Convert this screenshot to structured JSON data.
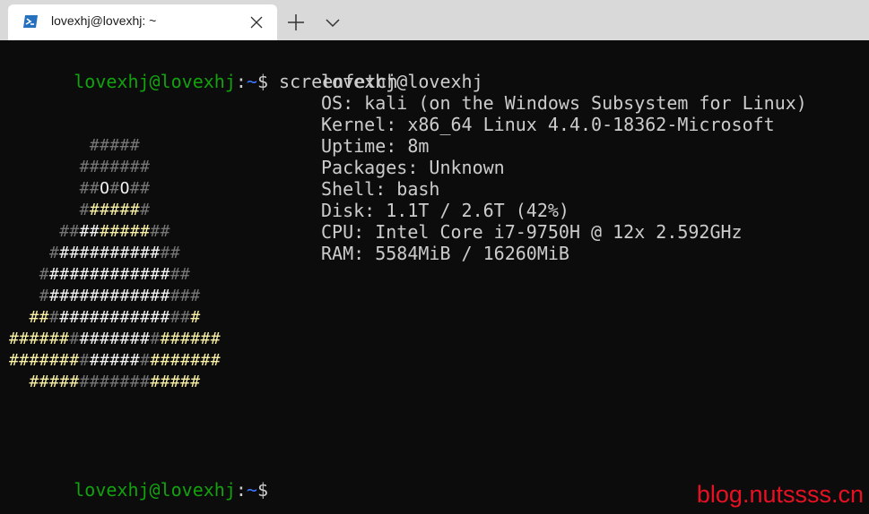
{
  "tab": {
    "title": "lovexhj@lovexhj: ~"
  },
  "icons": {
    "tab_icon": "powershell-icon",
    "close": "close-icon",
    "new_tab": "plus-icon",
    "dropdown": "chevron-down-icon"
  },
  "colors": {
    "prompt_user": "#13a10e",
    "prompt_path": "#3b78ff",
    "terminal_bg": "#0c0c0c",
    "terminal_fg": "#cccccc",
    "art_gray": "#767676",
    "art_white": "#f2f2f2",
    "art_yellow": "#f9f1a5",
    "watermark": "#e81123"
  },
  "prompt": {
    "user_host": "lovexhj@lovexhj",
    "colon": ":",
    "path": "~",
    "dollar": "$",
    "command": " screenfetch"
  },
  "info": [
    "lovexhj@lovexhj",
    "OS: kali (on the Windows Subsystem for Linux)",
    "Kernel: x86_64 Linux 4.4.0-18362-Microsoft",
    "Uptime: 8m",
    "Packages: Unknown",
    "Shell: bash",
    "Disk: 1.1T / 2.6T (42%)",
    "CPU: Intel Core i7-9750H @ 12x 2.592GHz",
    "RAM: 5584MiB / 16260MiB"
  ],
  "art": [
    [
      [
        "        ",
        ""
      ],
      [
        "#####",
        "g"
      ]
    ],
    [
      [
        "       ",
        ""
      ],
      [
        "#######",
        "g"
      ]
    ],
    [
      [
        "       ",
        ""
      ],
      [
        "##",
        "g"
      ],
      [
        "O",
        "w"
      ],
      [
        "#",
        "g"
      ],
      [
        "O",
        "w"
      ],
      [
        "##",
        "g"
      ]
    ],
    [
      [
        "       ",
        ""
      ],
      [
        "#",
        "g"
      ],
      [
        "#####",
        "y"
      ],
      [
        "#",
        "g"
      ]
    ],
    [
      [
        "     ",
        ""
      ],
      [
        "##",
        "g"
      ],
      [
        "##",
        "w"
      ],
      [
        "#####",
        "y"
      ],
      [
        "##",
        "g"
      ]
    ],
    [
      [
        "    ",
        ""
      ],
      [
        "#",
        "g"
      ],
      [
        "##########",
        "w"
      ],
      [
        "##",
        "g"
      ]
    ],
    [
      [
        "   ",
        ""
      ],
      [
        "#",
        "g"
      ],
      [
        "############",
        "w"
      ],
      [
        "##",
        "g"
      ]
    ],
    [
      [
        "   ",
        ""
      ],
      [
        "#",
        "g"
      ],
      [
        "############",
        "w"
      ],
      [
        "###",
        "g"
      ]
    ],
    [
      [
        "  ",
        ""
      ],
      [
        "##",
        "y"
      ],
      [
        "#",
        "g"
      ],
      [
        "###########",
        "w"
      ],
      [
        "##",
        "g"
      ],
      [
        "#",
        "y"
      ]
    ],
    [
      [
        "",
        ""
      ],
      [
        "######",
        "y"
      ],
      [
        "#",
        "g"
      ],
      [
        "#######",
        "w"
      ],
      [
        "#",
        "g"
      ],
      [
        "######",
        "y"
      ]
    ],
    [
      [
        "",
        ""
      ],
      [
        "#######",
        "y"
      ],
      [
        "#",
        "g"
      ],
      [
        "#####",
        "w"
      ],
      [
        "#",
        "g"
      ],
      [
        "#######",
        "y"
      ]
    ],
    [
      [
        "  ",
        ""
      ],
      [
        "#####",
        "y"
      ],
      [
        "#######",
        "g"
      ],
      [
        "#####",
        "y"
      ]
    ]
  ],
  "watermark": "blog.nutssss.cn"
}
